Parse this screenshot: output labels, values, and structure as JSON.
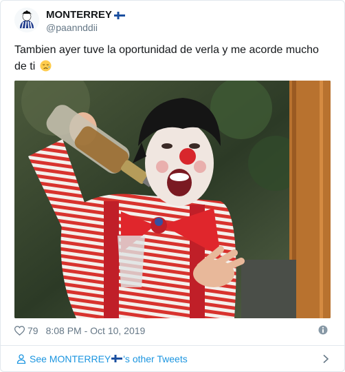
{
  "user": {
    "display_name": "MONTERREY",
    "handle": "@paannddii"
  },
  "tweet": {
    "text": "Tambien ayer tuve la oportunidad de verla y me acorde mucho de ti",
    "emoji_icon": "sad-relieved-face-icon"
  },
  "footer": {
    "like_count": "79",
    "timestamp": "8:08 PM - Oct 10, 2019"
  },
  "see_more": {
    "prefix": "See MONTERREY",
    "suffix": "'s other Tweets"
  },
  "colors": {
    "link": "#1b95e0",
    "secondary": "#657786",
    "border": "#e1e8ed"
  }
}
